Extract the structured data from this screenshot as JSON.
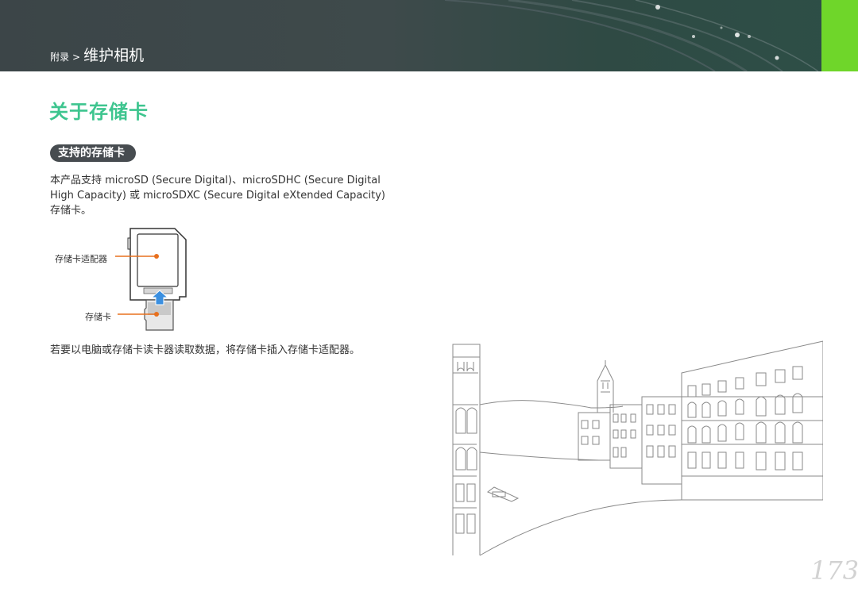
{
  "header": {
    "breadcrumb_parent": "附录",
    "breadcrumb_separator": ">",
    "breadcrumb_current": "维护相机",
    "accent_color": "#6fd62a"
  },
  "page": {
    "title": "关于存储卡",
    "title_color": "#3ec58f",
    "page_number": "173"
  },
  "section": {
    "heading": "支持的存储卡",
    "body_line1": "本产品支持 microSD (Secure Digital)、microSDHC (Secure Digital",
    "body_line2": "High Capacity) 或 microSDXC (Secure Digital eXtended Capacity)",
    "body_line3": "存储卡。",
    "diagram": {
      "adapter_label": "存储卡适配器",
      "card_label": "存储卡",
      "arrow_color": "#3a8fe0",
      "callout_color": "#e8701e"
    },
    "note": "若要以电脑或存储卡读卡器读取数据，将存储卡插入存储卡适配器。"
  }
}
